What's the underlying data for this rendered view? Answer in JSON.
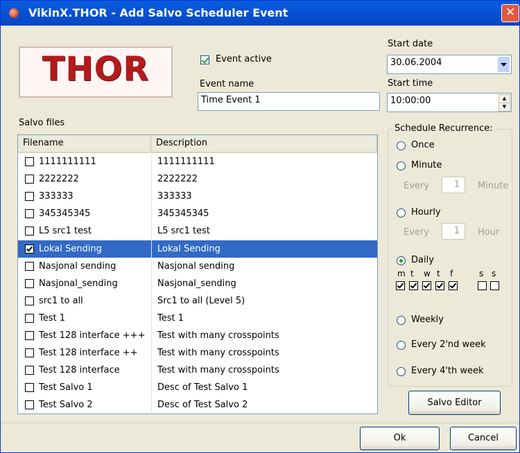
{
  "window": {
    "title": "VikinX.THOR - Add Salvo Scheduler Event",
    "close": "✕"
  },
  "logo": {
    "text": "THOR"
  },
  "event_active": {
    "label": "Event active",
    "checked": true
  },
  "event_name": {
    "label": "Event name",
    "value": "Time Event 1"
  },
  "start_date": {
    "label": "Start date",
    "value": "30.06.2004"
  },
  "start_time": {
    "label": "Start time",
    "value": "10:00:00"
  },
  "salvo_files": {
    "label": "Salvo files",
    "columns": [
      "Filename",
      "Description"
    ],
    "rows": [
      {
        "filename": "1111111111",
        "description": "1111111111",
        "checked": false,
        "selected": false
      },
      {
        "filename": "2222222",
        "description": "2222222",
        "checked": false,
        "selected": false
      },
      {
        "filename": "333333",
        "description": "333333",
        "checked": false,
        "selected": false
      },
      {
        "filename": "345345345",
        "description": "345345345",
        "checked": false,
        "selected": false
      },
      {
        "filename": "L5 src1 test",
        "description": "L5 src1 test",
        "checked": false,
        "selected": false
      },
      {
        "filename": "Lokal Sending",
        "description": "Lokal Sending",
        "checked": true,
        "selected": true
      },
      {
        "filename": "Nasjonal sending",
        "description": "Nasjonal sending",
        "checked": false,
        "selected": false
      },
      {
        "filename": "Nasjonal_sending",
        "description": "Nasjonal_sending",
        "checked": false,
        "selected": false
      },
      {
        "filename": "src1 to all",
        "description": "Src1 to all (Level 5)",
        "checked": false,
        "selected": false
      },
      {
        "filename": "Test 1",
        "description": "Test 1",
        "checked": false,
        "selected": false
      },
      {
        "filename": "Test 128 interface +++",
        "description": "Test with many crosspoints",
        "checked": false,
        "selected": false
      },
      {
        "filename": "Test 128 interface ++",
        "description": "Test with many crosspoints",
        "checked": false,
        "selected": false
      },
      {
        "filename": "Test 128 interface",
        "description": "Test with many crosspoints",
        "checked": false,
        "selected": false
      },
      {
        "filename": "Test Salvo 1",
        "description": "Desc of Test Salvo 1",
        "checked": false,
        "selected": false
      },
      {
        "filename": "Test Salvo 2",
        "description": "Desc of Test Salvo 2",
        "checked": false,
        "selected": false
      }
    ]
  },
  "recurrence": {
    "legend": "Schedule Recurrence:",
    "selected": "Daily",
    "once": "Once",
    "minute": "Minute",
    "minute_every": "Every",
    "minute_value": "1",
    "minute_unit": "Minute",
    "hourly": "Hourly",
    "hour_every": "Every",
    "hour_value": "1",
    "hour_unit": "Hour",
    "daily": "Daily",
    "days": [
      {
        "label": "m",
        "checked": true
      },
      {
        "label": "t",
        "checked": true
      },
      {
        "label": "w",
        "checked": true
      },
      {
        "label": "t",
        "checked": true
      },
      {
        "label": "f",
        "checked": true
      },
      {
        "label": "s",
        "checked": false
      },
      {
        "label": "s",
        "checked": false
      }
    ],
    "weekly": "Weekly",
    "every_2nd": "Every 2'nd week",
    "every_4th": "Every 4'th  week"
  },
  "buttons": {
    "salvo_editor": "Salvo Editor",
    "ok": "Ok",
    "cancel": "Cancel"
  },
  "colors": {
    "title_bar": "#0a5ddf",
    "selection": "#316ac5",
    "dialog_bg": "#ece9d8",
    "logo_text": "#b31b1b"
  }
}
